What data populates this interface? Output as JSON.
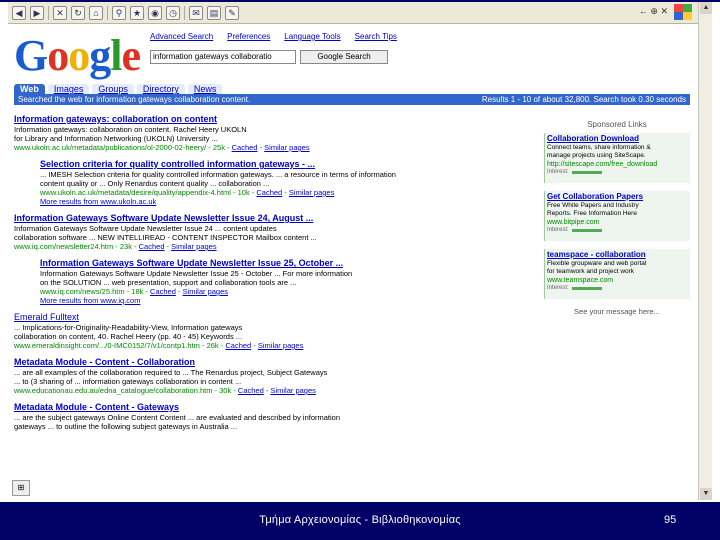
{
  "toolbar": {
    "icons": [
      "back-icon",
      "forward-icon",
      "stop-icon",
      "refresh-icon",
      "home-icon",
      "search-icon",
      "favorites-icon",
      "media-icon",
      "history-icon",
      "mail-icon",
      "print-icon",
      "edit-icon"
    ],
    "right_text": "← ⊕ ✕"
  },
  "google": {
    "logo_letters": [
      "G",
      "o",
      "o",
      "g",
      "l",
      "e"
    ],
    "top_links": [
      "Advanced Search",
      "Preferences",
      "Language Tools",
      "Search Tips"
    ],
    "query": "information gateways collaboratio",
    "search_button": "Google Search",
    "tabs": [
      "Web",
      "Images",
      "Groups",
      "Directory",
      "News"
    ],
    "bar_left": "Searched the web for information gateways collaboration content.",
    "bar_right": "Results 1 - 10 of about 32,800. Search took 0.30 seconds"
  },
  "results": [
    {
      "title": "Information gateways: collaboration on content",
      "snippet": [
        "Information gateways: collaboration on content. Rachel Heery UKOLN",
        "for Library and Information Networking (UKOLN) University ..."
      ],
      "url": "www.ukoln.ac.uk/metadata/publications/ol-2000-02-heery/ - 25k -",
      "cached": "Cached",
      "similar": "Similar pages",
      "indent": false
    },
    {
      "title": "Selection criteria for quality controlled information gateways - ...",
      "snippet": [
        "... IMESH Selection criteria for quality controlled information gateways. ... a resource in terms of information",
        "content quality or ... Only Renardus content quality ... collaboration ..."
      ],
      "url": "www.ukoln.ac.uk/metadata/desire/quality/appendix-4.html - 10k -",
      "cached": "Cached",
      "similar": "Similar pages",
      "more": "More results from www.ukoln.ac.uk",
      "indent": true
    },
    {
      "title": "Information Gateways Software Update Newsletter Issue 24, August ...",
      "snippet": [
        "Information Gateways Software Update Newsletter Issue 24 ... content updates",
        "collaboration software ... NEW INTELLIREAD - CONTENT INSPECTOR Mailbox content ..."
      ],
      "url": "www.iq.com/newsletter24.htm - 23k -",
      "cached": "Cached",
      "similar": "Similar pages",
      "indent": false
    },
    {
      "title": "Information Gateways Software Update Newsletter Issue 25, October ...",
      "snippet": [
        "Information Gateways Software Update Newsletter Issue 25 - October ... For more information",
        "on the SOLUTION ... web presentation, support and collaboration tools are ..."
      ],
      "url": "www.iq.com/news/25.htm - 18k -",
      "cached": "Cached",
      "similar": "Similar pages",
      "more": "More results from www.iq.com",
      "indent": true
    },
    {
      "title": "Emerald Fulltext",
      "snippet": [
        "... Implications-for-Originality-Readability-View, Information gateways",
        "collaboration on content, 40. Rachel Heery (pp. 40 - 45) Keywords ..."
      ],
      "url": "www.emeraldinsight.com/.../0-IMC0152/7/v1/contp1.htm - 26k -",
      "cached": "Cached",
      "similar": "Similar pages",
      "indent": false
    },
    {
      "title": "Metadata Module - Content - Collaboration",
      "snippet": [
        "... are all examples of the collaboration required to ... The Renardus project, Subject Gateways",
        "... to (3 sharing of ... information gateways collaboration in content ..."
      ],
      "url": "www.educationau.edu.au/edna_catalogue/collaboration.htm - 30k -",
      "cached": "Cached",
      "similar": "Similar pages",
      "indent": false
    },
    {
      "title": "Metadata Module - Content - Gateways",
      "snippet": [
        "... are the subject gateways Online Content Content ... are evaluated and described by information",
        "gateways ... to outline the following subject gateways in Australia ..."
      ],
      "url": "",
      "cached": "",
      "similar": "",
      "indent": false
    }
  ],
  "sponsored": {
    "heading": "Sponsored Links",
    "ads": [
      {
        "title": "Collaboration Download",
        "text": [
          "Connect teams, share information &",
          "manage projects using SiteScape."
        ],
        "url": "http://sitescape.com/free_download",
        "interest": "Interest:"
      },
      {
        "title": "Get Collaboration Papers",
        "text": [
          "Free White Papers and Industry",
          "Reports. Free Information Here"
        ],
        "url": "www.bitpipe.com",
        "interest": "Interest:"
      },
      {
        "title": "teamspace - collaboration",
        "text": [
          "Flexible groupware and web portal",
          "for teamwork and project work"
        ],
        "url": "www.teamspace.com",
        "interest": "Interest:"
      }
    ],
    "footer": "See your message here..."
  },
  "footer": {
    "title": "Τμήμα Αρχειονομίας - Βιβλιοθηκονομίας",
    "page": "95"
  }
}
